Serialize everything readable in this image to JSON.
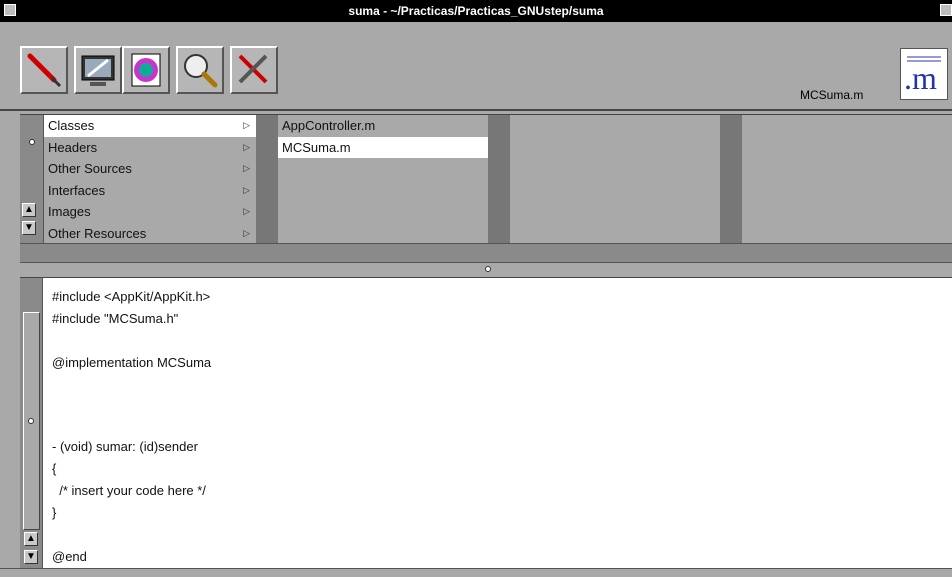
{
  "window": {
    "title": "suma - ~/Practicas/Practicas_GNUstep/suma"
  },
  "toolbar": {
    "tools": [
      "build-icon",
      "launch-icon",
      "project-icon",
      "search-icon",
      "settings-icon"
    ],
    "current_file": "MCSuma.m",
    "file_type_icon": "m-file-icon"
  },
  "browser": {
    "categories": [
      {
        "label": "Classes",
        "selected": true
      },
      {
        "label": "Headers",
        "selected": false
      },
      {
        "label": "Other Sources",
        "selected": false
      },
      {
        "label": "Interfaces",
        "selected": false
      },
      {
        "label": "Images",
        "selected": false
      },
      {
        "label": "Other Resources",
        "selected": false
      }
    ],
    "files": [
      {
        "label": "AppController.m",
        "selected": false
      },
      {
        "label": "MCSuma.m",
        "selected": true
      }
    ]
  },
  "editor": {
    "lines": [
      "#include <AppKit/AppKit.h>",
      "#include \"MCSuma.h\"",
      "",
      "@implementation MCSuma",
      "",
      "",
      "",
      "- (void) sumar: (id)sender",
      "{",
      "  /* insert your code here */",
      "}",
      "",
      "@end"
    ]
  }
}
